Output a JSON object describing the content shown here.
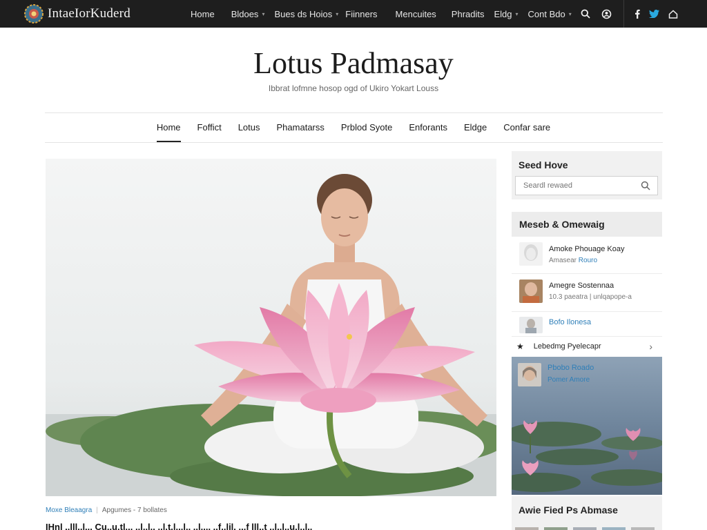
{
  "topbar": {
    "brand": "IntaeIorKuderd",
    "nav": [
      {
        "label": "Home",
        "dropdown": false
      },
      {
        "label": "Bldoes",
        "dropdown": true
      },
      {
        "label": "Bues ds Hoios",
        "dropdown": true
      },
      {
        "label": "Fiinners",
        "dropdown": false
      },
      {
        "label": "Mencuites",
        "dropdown": false
      },
      {
        "label": "Phradits",
        "dropdown": false
      },
      {
        "label": "Eldg",
        "dropdown": true
      },
      {
        "label": "Cont Bdo",
        "dropdown": true
      }
    ],
    "icons": [
      "search-icon",
      "user-circle-icon",
      "facebook-icon",
      "twitter-icon",
      "home-icon"
    ]
  },
  "header": {
    "title": "Lotus Padmasay",
    "tagline": "Ibbrat lofmne hosop ogd of Ukiro Yokart Louss"
  },
  "main_nav": [
    {
      "label": "Home",
      "active": true
    },
    {
      "label": "Foffict",
      "active": false
    },
    {
      "label": "Lotus",
      "active": false
    },
    {
      "label": "Phamatarss",
      "active": false
    },
    {
      "label": "Prblod Syote",
      "active": false
    },
    {
      "label": "Enforants",
      "active": false
    },
    {
      "label": "Eldge",
      "active": false
    },
    {
      "label": "Confar sare",
      "active": false
    }
  ],
  "post": {
    "category": "Moxe Bleaagra",
    "meta": "Apgumes - 7 bollates",
    "excerpt": "IHnl ..lll..l... Cu..u.tl... ..l..l.. ..l.t.l...l.. ..l.... ..f..lil. ...f lll..t ..l..l..u.l..l.."
  },
  "sidebar": {
    "search": {
      "title": "Seed Hove",
      "placeholder": "Seardl rewaed"
    },
    "recent": {
      "title": "Meseb & Omewaig",
      "items": [
        {
          "title": "Amoke Phouage Koay",
          "sub_prefix": "Amasear",
          "sub_link": "Rouro"
        },
        {
          "title": "Amegre Sostennaa",
          "sub": "10.3 paeatra | unlqapope-a"
        },
        {
          "title": "Bofo Ilonesa",
          "sub": ""
        }
      ],
      "subscribe": "Lebedmg Pyelecapr",
      "panel": {
        "title": "Pbobo Roado",
        "sub": "Pomer Amore"
      }
    },
    "bottom": {
      "title": "Awie Fied Ps Abmase"
    }
  },
  "colors": {
    "topbar_bg": "#1e1e1e",
    "accent": "#2f7fb8",
    "lotus_pink": "#e58db0"
  }
}
